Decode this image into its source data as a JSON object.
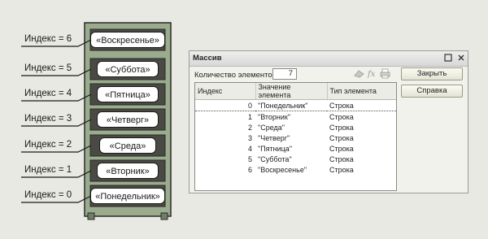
{
  "illustration": {
    "index_labels": [
      "Индекс = 6",
      "Индекс = 5",
      "Индекс = 4",
      "Индекс = 3",
      "Индекс = 2",
      "Индекс = 1",
      "Индекс = 0"
    ],
    "items": [
      "«Воскресенье»",
      "«Суббота»",
      "«Пятница»",
      "«Четверг»",
      "«Среда»",
      "«Вторник»",
      "«Понедельник»"
    ],
    "colors": {
      "frame_light": "#9aab8e",
      "frame_dark": "#6f7f66",
      "shelf_bg": "#4a4a44",
      "chip_bg": "#ffffff"
    }
  },
  "dialog": {
    "title": "Массив",
    "count_label": "Количество элементов:",
    "count_value": "7",
    "columns": [
      "Индекс",
      "Значение элемента",
      "Тип элемента"
    ],
    "rows": [
      [
        "0",
        "\"Понедельник\"",
        "Строка"
      ],
      [
        "1",
        "\"Вторник\"",
        "Строка"
      ],
      [
        "2",
        "\"Среда\"",
        "Строка"
      ],
      [
        "3",
        "\"Четверг\"",
        "Строка"
      ],
      [
        "4",
        "\"Пятница\"",
        "Строка"
      ],
      [
        "5",
        "\"Суббота\"",
        "Строка"
      ],
      [
        "6",
        "\"Воскресенье\"",
        "Строка"
      ]
    ],
    "close_button": "Закрыть",
    "help_button": "Справка",
    "titlebar_icons": [
      "maximize-icon",
      "close-icon"
    ],
    "toolbar_icons": [
      "hat-icon",
      "function-icon",
      "printer-icon"
    ]
  }
}
